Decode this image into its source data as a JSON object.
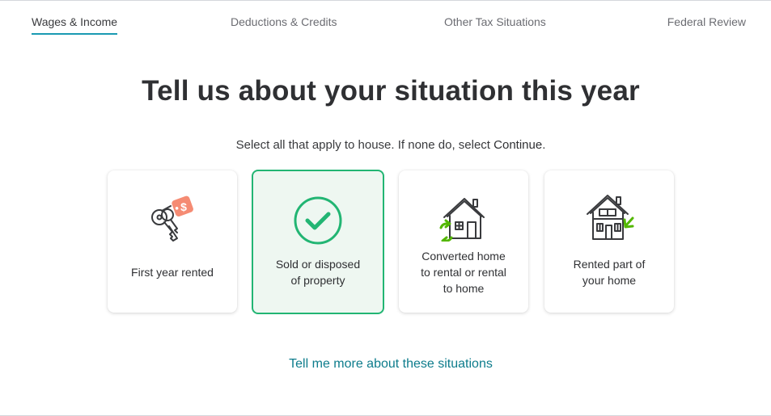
{
  "nav": {
    "tabs": [
      {
        "label": "Wages & Income",
        "active": true
      },
      {
        "label": "Deductions & Credits",
        "active": false
      },
      {
        "label": "Other Tax Situations",
        "active": false
      },
      {
        "label": "Federal Review",
        "active": false
      }
    ]
  },
  "main": {
    "title": "Tell us about your situation this year",
    "subtitle_prefix": "Select all that apply to house. If none do, select ",
    "subtitle_action": "Continue",
    "subtitle_suffix": ".",
    "cards": [
      {
        "label": "First year rented",
        "icon": "keys-dollar-tag-icon",
        "selected": false
      },
      {
        "label_line1": "Sold or disposed",
        "label_line2": "of property",
        "icon": "checkmark-circle-icon",
        "selected": true
      },
      {
        "label_line1": "Converted home",
        "label_line2": "to rental or rental",
        "label_line3": "to home",
        "icon": "house-convert-icon",
        "selected": false
      },
      {
        "label_line1": "Rented part of",
        "label_line2": "your home",
        "icon": "house-rented-part-icon",
        "selected": false
      }
    ],
    "more_link": "Tell me more about these situations"
  },
  "colors": {
    "accent_underline": "#1a9ab2",
    "selected_green": "#22b573",
    "link_teal": "#0d7c8c",
    "tag_salmon": "#f58b73"
  }
}
